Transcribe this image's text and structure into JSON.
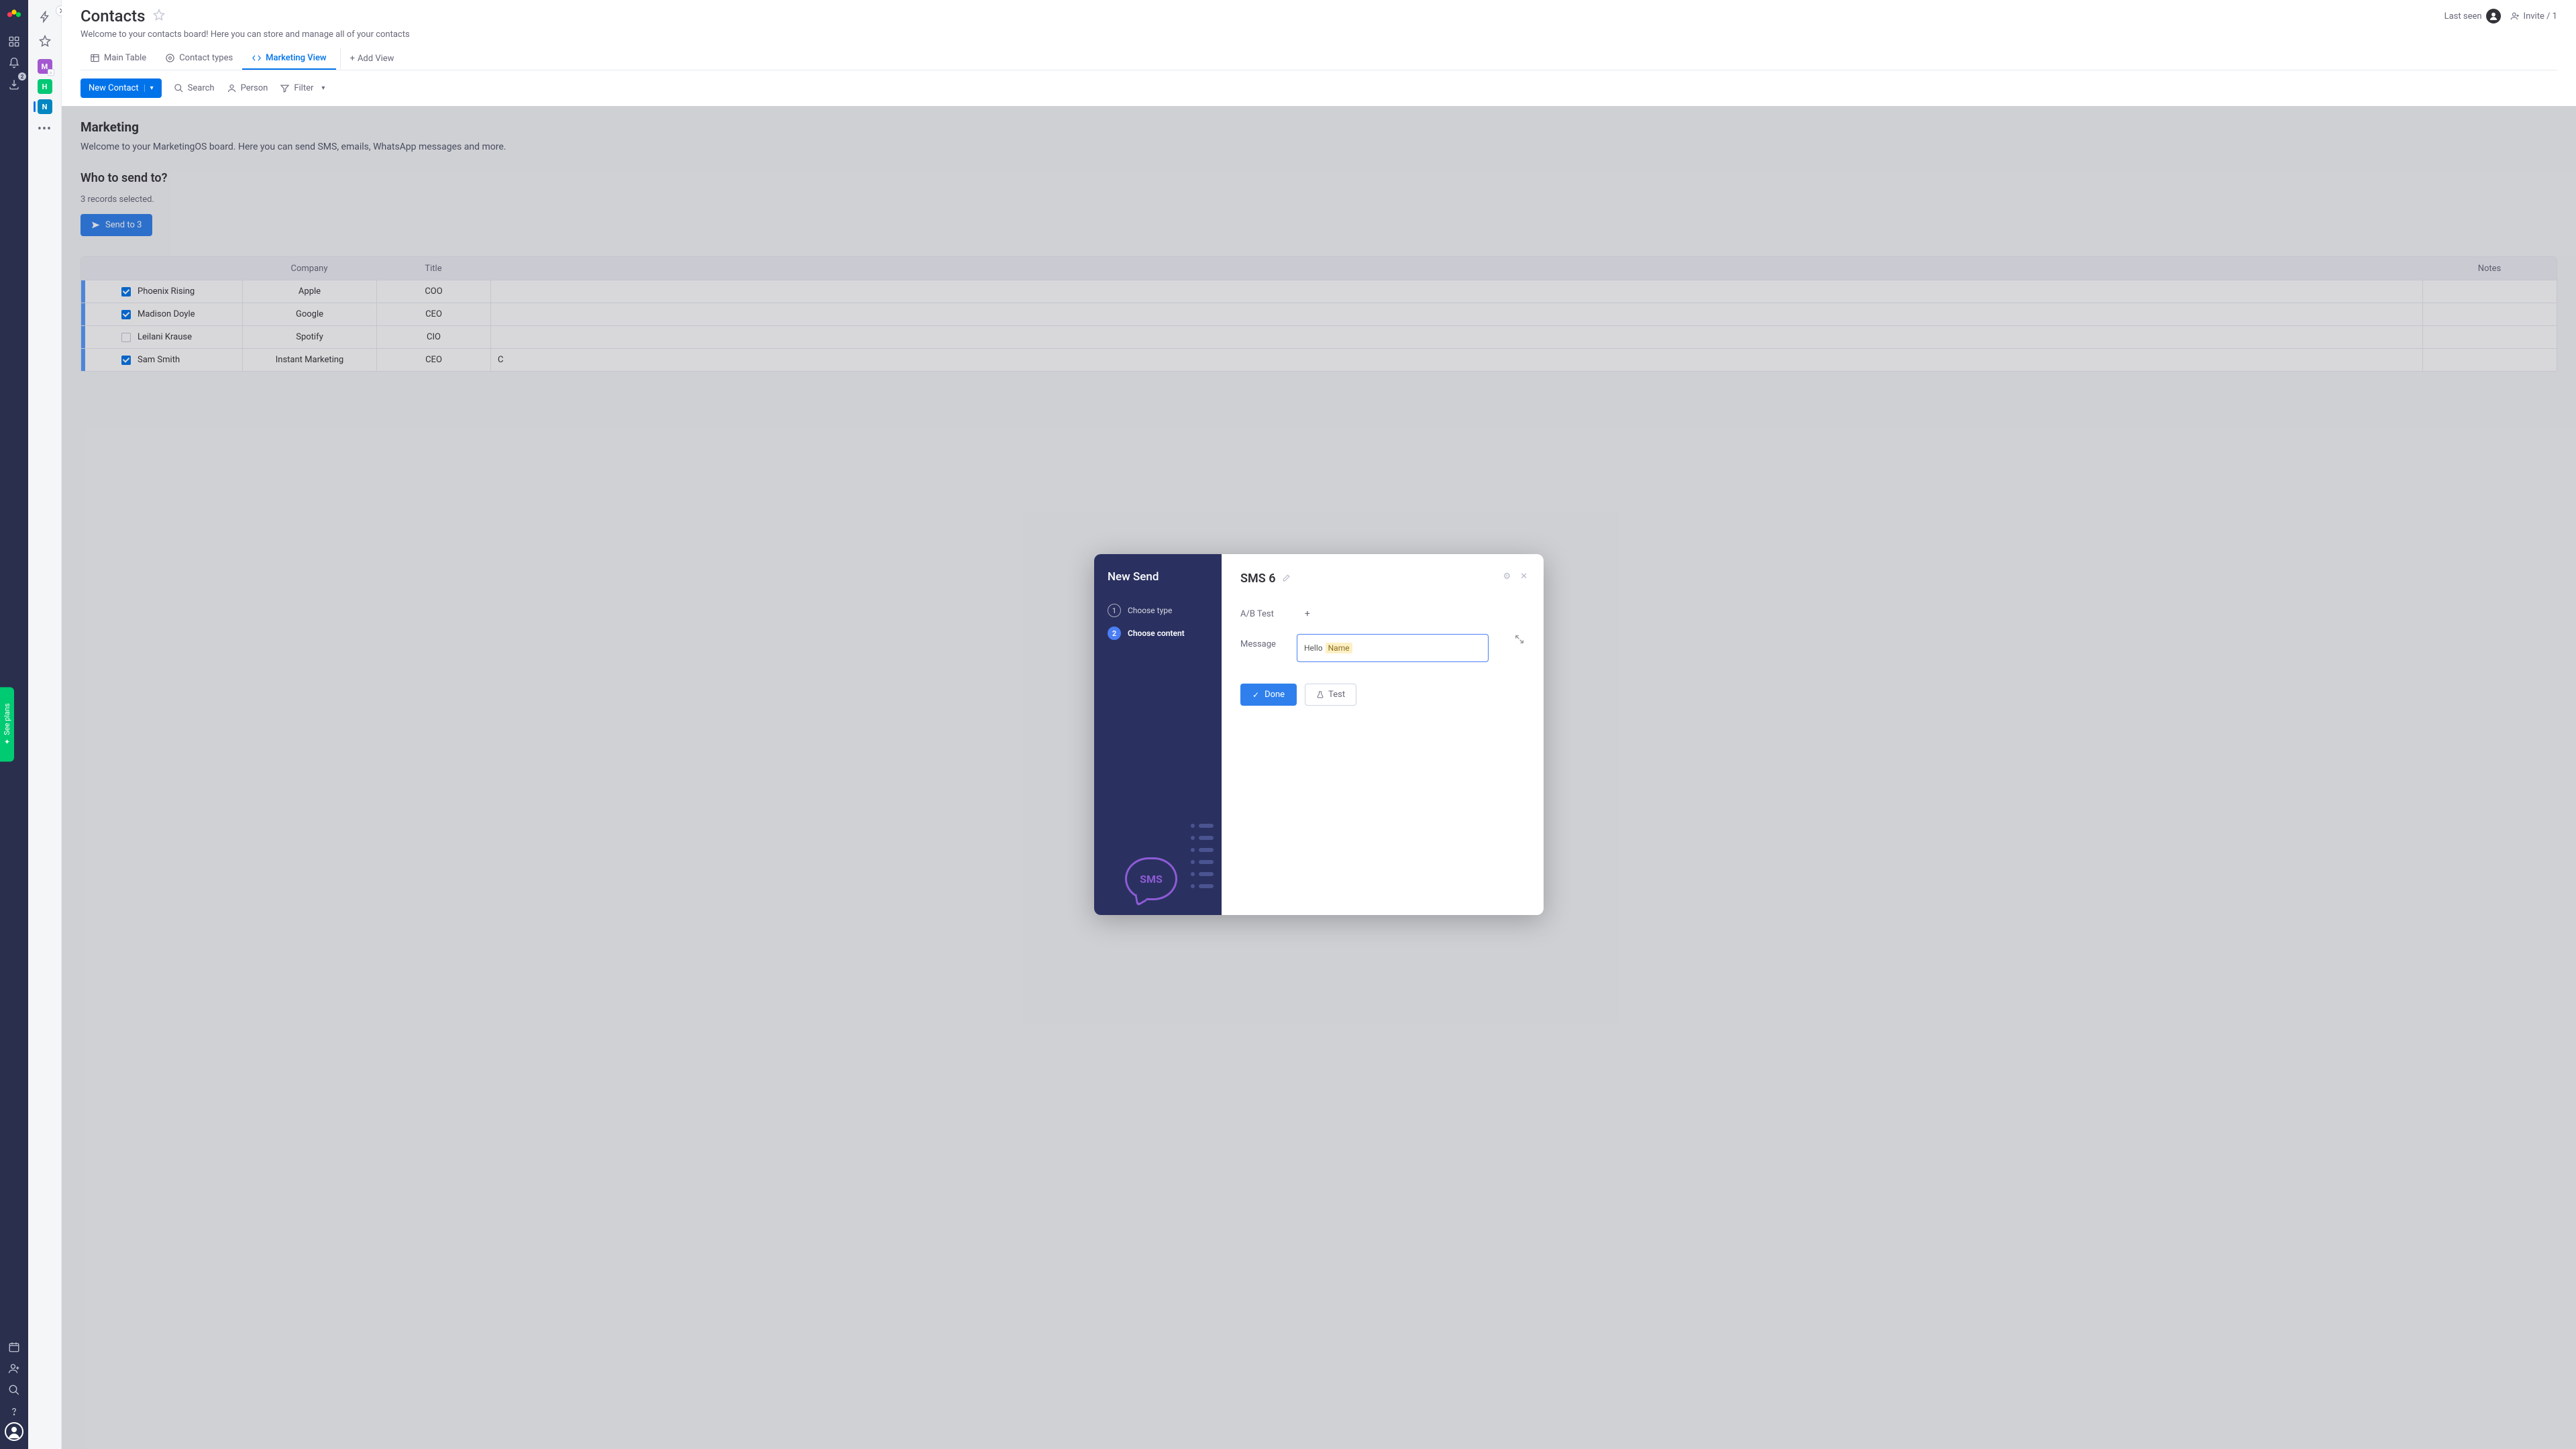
{
  "rail": {
    "download_badge": "2"
  },
  "workspaces": {
    "m": "M",
    "h": "H",
    "n": "N"
  },
  "header": {
    "title": "Contacts",
    "subtitle": "Welcome to your contacts board! Here you can store and manage all of your contacts",
    "last_seen": "Last seen",
    "invite": "Invite / 1"
  },
  "tabs": {
    "main_table": "Main Table",
    "contact_types": "Contact types",
    "marketing_view": "Marketing View",
    "add_view": "Add View"
  },
  "toolbar": {
    "new_contact": "New Contact",
    "search": "Search",
    "person": "Person",
    "filter": "Filter"
  },
  "body": {
    "section_title": "Marketing",
    "section_desc": "Welcome to your MarketingOS board. Here you can send SMS, emails, WhatsApp messages and more.",
    "who_title": "Who to send to?",
    "selected_text": "3 records selected.",
    "send_btn": "Send to 3"
  },
  "table": {
    "headers": {
      "company": "Company",
      "title": "Title",
      "notes": "Notes"
    },
    "rows": [
      {
        "checked": true,
        "name": "Phoenix Rising",
        "company": "Apple",
        "title": "COO",
        "extra": ""
      },
      {
        "checked": true,
        "name": "Madison Doyle",
        "company": "Google",
        "title": "CEO",
        "extra": ""
      },
      {
        "checked": false,
        "name": "Leilani Krause",
        "company": "Spotify",
        "title": "CIO",
        "extra": ""
      },
      {
        "checked": true,
        "name": "Sam Smith",
        "company": "Instant Marketing",
        "title": "CEO",
        "extra": "C"
      }
    ]
  },
  "modal": {
    "left_title": "New Send",
    "step1": "Choose type",
    "step2": "Choose content",
    "sms_art": "SMS",
    "title": "SMS 6",
    "ab": "A/B Test",
    "msg_label": "Message",
    "msg_prefix": "Hello",
    "msg_token": "Name",
    "done": "Done",
    "test": "Test"
  },
  "see_plans": "✦ See plans"
}
